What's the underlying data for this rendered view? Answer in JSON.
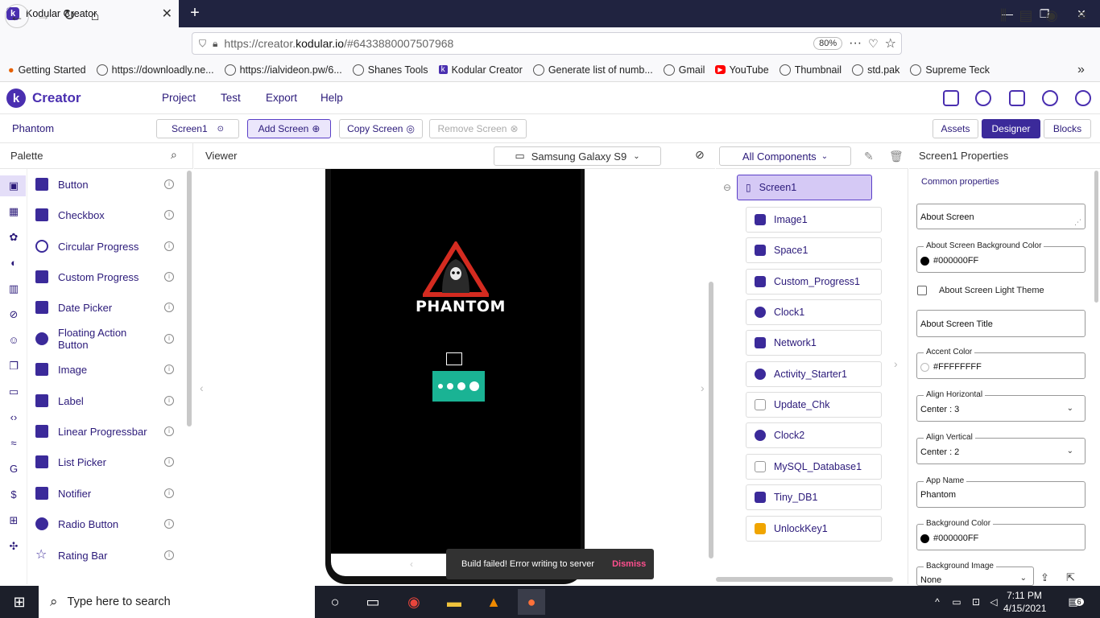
{
  "browser": {
    "tab_title": "Kodular Creator",
    "url_prefix": "https://creator.",
    "url_domain": "kodular.io",
    "url_suffix": "/#6433880007507968",
    "zoom": "80%",
    "bookmarks": [
      "Getting Started",
      "https://downloadly.ne...",
      "https://ialvideon.pw/6...",
      "Shanes Tools",
      "Kodular Creator",
      "Generate list of numb...",
      "Gmail",
      "YouTube",
      "Thumbnail",
      "std.pak",
      "Supreme Teck"
    ]
  },
  "app": {
    "brand": "Creator",
    "menu": [
      "Project",
      "Test",
      "Export",
      "Help"
    ],
    "project_name": "Phantom",
    "screen_select": "Screen1",
    "add_screen": "Add Screen",
    "copy_screen": "Copy Screen",
    "remove_screen": "Remove Screen",
    "assets": "Assets",
    "designer": "Designer",
    "blocks": "Blocks"
  },
  "palette": {
    "title": "Palette",
    "items": [
      "Button",
      "Checkbox",
      "Circular Progress",
      "Custom Progress",
      "Date Picker",
      "Floating Action Button",
      "Image",
      "Label",
      "Linear Progressbar",
      "List Picker",
      "Notifier",
      "Radio Button",
      "Rating Bar"
    ]
  },
  "viewer": {
    "title": "Viewer",
    "device": "Samsung Galaxy S9",
    "logo_text": "PHANTOM"
  },
  "components": {
    "filter": "All Components",
    "root": "Screen1",
    "items": [
      "Image1",
      "Space1",
      "Custom_Progress1",
      "Clock1",
      "Network1",
      "Activity_Starter1",
      "Update_Chk",
      "Clock2",
      "MySQL_Database1",
      "Tiny_DB1",
      "UnlockKey1"
    ]
  },
  "properties": {
    "title": "Screen1 Properties",
    "section": "Common properties",
    "about_screen": "About Screen",
    "about_bg_label": "About Screen Background Color",
    "about_bg_value": "#000000FF",
    "light_theme": "About Screen Light Theme",
    "about_title": "About Screen Title",
    "accent_label": "Accent Color",
    "accent_value": "#FFFFFFFF",
    "align_h_label": "Align Horizontal",
    "align_h_value": "Center : 3",
    "align_v_label": "Align Vertical",
    "align_v_value": "Center : 2",
    "app_name_label": "App Name",
    "app_name_value": "Phantom",
    "bg_color_label": "Background Color",
    "bg_color_value": "#000000FF",
    "bg_image_label": "Background Image",
    "bg_image_value": "None"
  },
  "snackbar": {
    "message": "Build failed! Error writing to server",
    "action": "Dismiss"
  },
  "taskbar": {
    "search": "Type here to search",
    "time": "7:11 PM",
    "date": "4/15/2021",
    "notifications": "6"
  },
  "colors": {
    "accent": "#4a2fb0",
    "selected": "#d5c9f5",
    "progress": "#1ab394",
    "snack_action": "#ff4f8e"
  }
}
